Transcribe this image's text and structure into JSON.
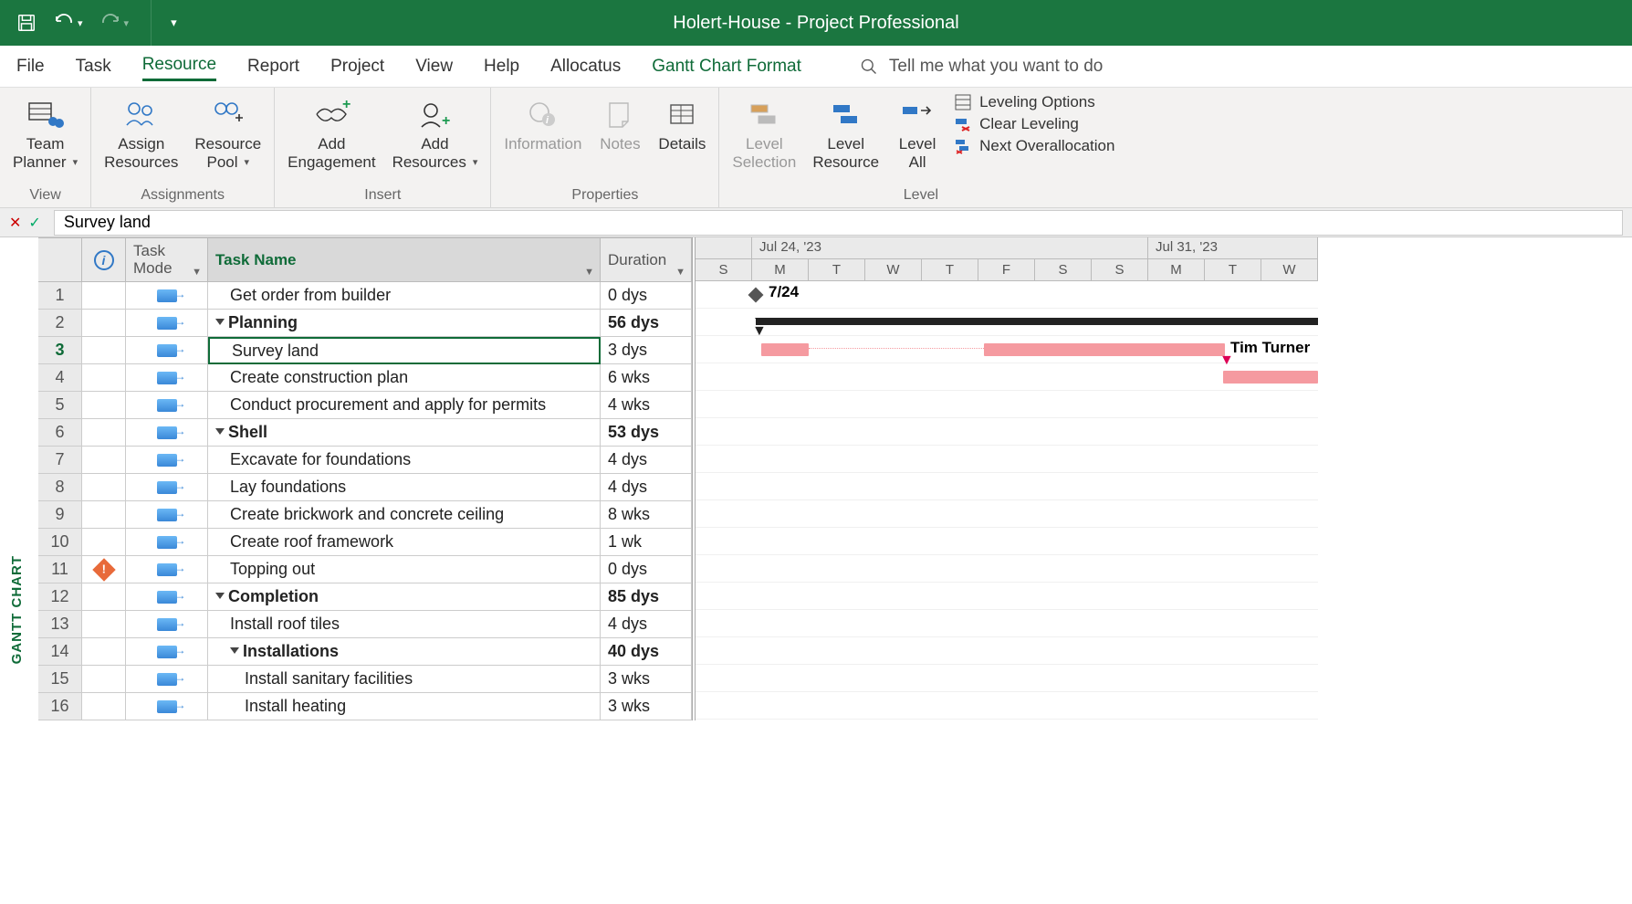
{
  "title_bar": {
    "doc_title": "Holert-House  -  Project Professional"
  },
  "tabs": {
    "file": "File",
    "task": "Task",
    "resource": "Resource",
    "report": "Report",
    "project": "Project",
    "view": "View",
    "help": "Help",
    "allocatus": "Allocatus",
    "format": "Gantt Chart Format",
    "tell_me": "Tell me what you want to do"
  },
  "ribbon": {
    "view_group": "View",
    "team_planner_l1": "Team",
    "team_planner_l2": "Planner",
    "assignments_group": "Assignments",
    "assign_l1": "Assign",
    "assign_l2": "Resources",
    "pool_l1": "Resource",
    "pool_l2": "Pool",
    "insert_group": "Insert",
    "add_eng_l1": "Add",
    "add_eng_l2": "Engagement",
    "add_res_l1": "Add",
    "add_res_l2": "Resources",
    "properties_group": "Properties",
    "info": "Information",
    "notes": "Notes",
    "details": "Details",
    "level_group": "Level",
    "lvl_sel_l1": "Level",
    "lvl_sel_l2": "Selection",
    "lvl_res_l1": "Level",
    "lvl_res_l2": "Resource",
    "lvl_all_l1": "Level",
    "lvl_all_l2": "All",
    "lvl_opts": "Leveling Options",
    "lvl_clear": "Clear Leveling",
    "lvl_next": "Next Overallocation"
  },
  "formula": {
    "value": "Survey land"
  },
  "columns": {
    "task_mode_l1": "Task",
    "task_mode_l2": "Mode",
    "task_name": "Task Name",
    "duration": "Duration"
  },
  "gantt_label": "GANTT CHART",
  "timeline": {
    "week1": "Jul 24, '23",
    "week2": "Jul 31, '23",
    "days": [
      "S",
      "M",
      "T",
      "W",
      "T",
      "F",
      "S",
      "S",
      "M",
      "T",
      "W"
    ],
    "milestone_label": "7/24",
    "resource_label": "Tim Turner"
  },
  "rows": [
    {
      "num": "1",
      "name": "Get order from builder",
      "dur": "0 dys",
      "indent": 1,
      "bold": false,
      "summary": false,
      "alert": false
    },
    {
      "num": "2",
      "name": "Planning",
      "dur": "56 dys",
      "indent": 0,
      "bold": true,
      "summary": true,
      "alert": false
    },
    {
      "num": "3",
      "name": "Survey land",
      "dur": "3 dys",
      "indent": 1,
      "bold": false,
      "summary": false,
      "alert": false,
      "selected": true
    },
    {
      "num": "4",
      "name": "Create construction plan",
      "dur": "6 wks",
      "indent": 1,
      "bold": false,
      "summary": false,
      "alert": false
    },
    {
      "num": "5",
      "name": "Conduct procurement and apply for permits",
      "dur": "4 wks",
      "indent": 1,
      "bold": false,
      "summary": false,
      "alert": false
    },
    {
      "num": "6",
      "name": "Shell",
      "dur": "53 dys",
      "indent": 0,
      "bold": true,
      "summary": true,
      "alert": false
    },
    {
      "num": "7",
      "name": "Excavate for foundations",
      "dur": "4 dys",
      "indent": 1,
      "bold": false,
      "summary": false,
      "alert": false
    },
    {
      "num": "8",
      "name": "Lay foundations",
      "dur": "4 dys",
      "indent": 1,
      "bold": false,
      "summary": false,
      "alert": false
    },
    {
      "num": "9",
      "name": "Create brickwork and concrete ceiling",
      "dur": "8 wks",
      "indent": 1,
      "bold": false,
      "summary": false,
      "alert": false
    },
    {
      "num": "10",
      "name": "Create roof framework",
      "dur": "1 wk",
      "indent": 1,
      "bold": false,
      "summary": false,
      "alert": false
    },
    {
      "num": "11",
      "name": "Topping out",
      "dur": "0 dys",
      "indent": 1,
      "bold": false,
      "summary": false,
      "alert": true
    },
    {
      "num": "12",
      "name": "Completion",
      "dur": "85 dys",
      "indent": 0,
      "bold": true,
      "summary": true,
      "alert": false
    },
    {
      "num": "13",
      "name": "Install roof tiles",
      "dur": "4 dys",
      "indent": 1,
      "bold": false,
      "summary": false,
      "alert": false
    },
    {
      "num": "14",
      "name": "Installations",
      "dur": "40 dys",
      "indent": 1,
      "bold": true,
      "summary": true,
      "alert": false
    },
    {
      "num": "15",
      "name": "Install sanitary facilities",
      "dur": "3 wks",
      "indent": 2,
      "bold": false,
      "summary": false,
      "alert": false
    },
    {
      "num": "16",
      "name": "Install heating",
      "dur": "3 wks",
      "indent": 2,
      "bold": false,
      "summary": false,
      "alert": false
    }
  ]
}
